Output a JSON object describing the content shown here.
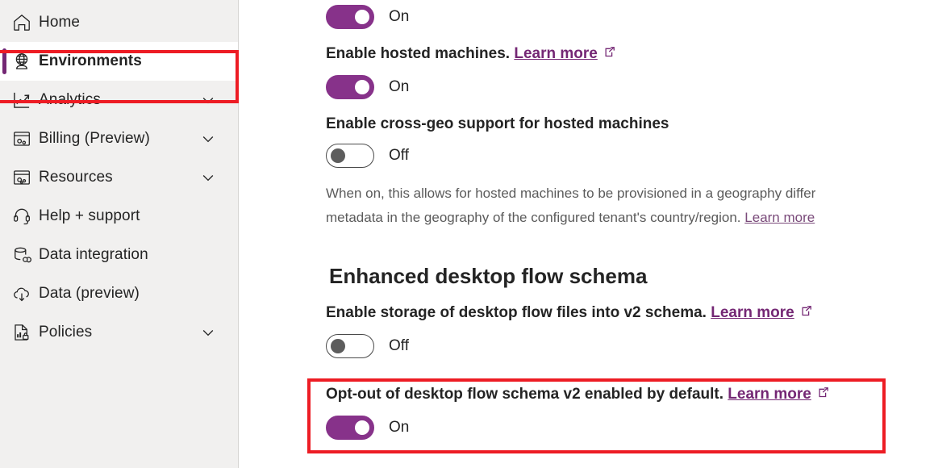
{
  "sidebar": {
    "items": [
      {
        "label": "Home",
        "icon": "home-icon",
        "expandable": false,
        "active": false
      },
      {
        "label": "Environments",
        "icon": "globe-icon",
        "expandable": false,
        "active": true
      },
      {
        "label": "Analytics",
        "icon": "analytics-icon",
        "expandable": true,
        "active": false
      },
      {
        "label": "Billing (Preview)",
        "icon": "billing-icon",
        "expandable": true,
        "active": false
      },
      {
        "label": "Resources",
        "icon": "resources-icon",
        "expandable": true,
        "active": false
      },
      {
        "label": "Help + support",
        "icon": "headset-icon",
        "expandable": false,
        "active": false
      },
      {
        "label": "Data integration",
        "icon": "data-integration-icon",
        "expandable": false,
        "active": false
      },
      {
        "label": "Data (preview)",
        "icon": "data-cloud-icon",
        "expandable": false,
        "active": false
      },
      {
        "label": "Policies",
        "icon": "policies-icon",
        "expandable": true,
        "active": false
      }
    ]
  },
  "main": {
    "settings": [
      {
        "id": "clipped-top-setting",
        "label": "",
        "toggle_state": "On",
        "toggle_on": true,
        "link": "",
        "has_link": false
      },
      {
        "id": "enable-hosted-machines",
        "label": "Enable hosted machines.",
        "toggle_state": "On",
        "toggle_on": true,
        "link": "Learn more",
        "has_link": true
      },
      {
        "id": "enable-cross-geo-support",
        "label": "Enable cross-geo support for hosted machines",
        "toggle_state": "Off",
        "toggle_on": false,
        "link": "",
        "has_link": false
      }
    ],
    "cross_geo_description_line1": "When on, this allows for hosted machines to be provisioned in a geography differ",
    "cross_geo_description_line2": "metadata in the geography of the configured tenant's country/region.",
    "cross_geo_description_link": "Learn more",
    "section": {
      "heading": "Enhanced desktop flow schema",
      "settings": [
        {
          "id": "enable-storage-v2-schema",
          "label": "Enable storage of desktop flow files into v2 schema.",
          "link": "Learn more",
          "toggle_state": "Off",
          "toggle_on": false
        },
        {
          "id": "opt-out-schema-v2",
          "label": "Opt-out of desktop flow schema v2 enabled by default.",
          "link": "Learn more",
          "toggle_state": "On",
          "toggle_on": true
        }
      ]
    }
  },
  "colors": {
    "accent_purple": "#742774",
    "toggle_on": "#87328a",
    "highlight_red": "#ed1c24",
    "sidebar_bg": "#f1f0ef",
    "text": "#242424",
    "muted_text": "#5b5b5b"
  },
  "highlights": [
    {
      "name": "sidebar-environments-highlight",
      "target": "Environments"
    },
    {
      "name": "opt-out-setting-highlight",
      "target": "Opt-out of desktop flow schema v2 enabled by default."
    }
  ]
}
